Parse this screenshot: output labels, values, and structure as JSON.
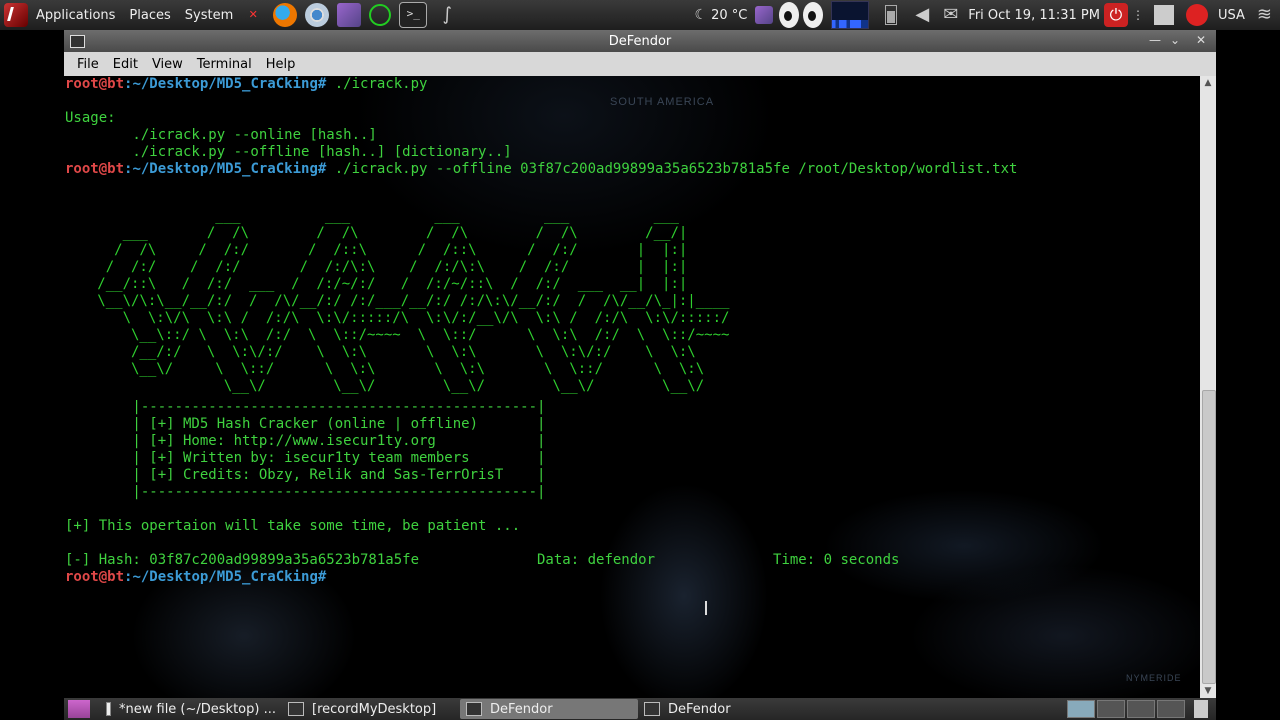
{
  "top_panel": {
    "menus": [
      "Applications",
      "Places",
      "System"
    ],
    "launchers": [
      {
        "icon": "chat-icon"
      },
      {
        "icon": "firefox-icon"
      },
      {
        "icon": "chrome-icon"
      },
      {
        "icon": "network-tool-icon"
      },
      {
        "icon": "wireless-icon"
      },
      {
        "icon": "terminal-icon"
      },
      {
        "icon": "wireshark-icon"
      }
    ],
    "chat_label": "chat",
    "weather": "20 °C",
    "clock": "Fri Oct 19, 11:31 PM",
    "keyboard_layout": "USA"
  },
  "window": {
    "title": "DeFendor",
    "menus": [
      {
        "label": "File"
      },
      {
        "label": "Edit"
      },
      {
        "label": "View"
      },
      {
        "label": "Terminal"
      },
      {
        "label": "Help"
      }
    ]
  },
  "terminal": {
    "prompt_user": "root@bt",
    "prompt_path": ":~/Desktop/MD5_CraCking#",
    "commands": [
      " ./icrack.py",
      " ./icrack.py --offline 03f87c200ad99899a35a6523b781a5fe /root/Desktop/wordlist.txt"
    ],
    "usage_title": "Usage:",
    "usage_lines": [
      "        ./icrack.py --online [hash..]",
      "        ./icrack.py --offline [hash..] [dictionary..]"
    ],
    "banner_ascii": "                 ___          ___          ___          ___          ___\n      ___       /  /\\        /  /\\        /  /\\        /  /\\        /__/|\n     /  /\\     /  /:/       /  /::\\      /  /::\\      /  /:/       |  |:|\n    /  /:/    /  /:/       /  /:/\\:\\    /  /:/\\:\\    /  /:/        |  |:|\n   /__/::\\   /  /:/  ___  /  /:/~/:/   /  /:/~/::\\  /  /:/  ___  __|  |:|\n   \\__\\/\\:\\__/__/:/  /  /\\/__/:/ /:/___/__/:/ /:/\\:\\/__/:/  /  /\\/__/\\_|:|____\n      \\  \\:\\/\\  \\:\\ /  /:/\\  \\:\\/:::::/\\  \\:\\/:/__\\/\\  \\:\\ /  /:/\\  \\:\\/:::::/\n       \\__\\::/ \\  \\:\\  /:/  \\  \\::/~~~~  \\  \\::/      \\  \\:\\  /:/  \\  \\::/~~~~\n       /__/:/   \\  \\:\\/:/    \\  \\:\\       \\  \\:\\       \\  \\:\\/:/    \\  \\:\\\n       \\__\\/     \\  \\::/      \\  \\:\\       \\  \\:\\       \\  \\::/      \\  \\:\\\n                  \\__\\/        \\__\\/        \\__\\/        \\__\\/        \\__\\/",
    "info_box": [
      "        |-----------------------------------------------|",
      "        | [+] MD5 Hash Cracker (online | offline)       |",
      "        | [+] Home: http://www.isecur1ty.org            |",
      "        | [+] Written by: isecur1ty team members        |",
      "        | [+] Credits: Obzy, Relik and Sas-TerrOrisT    |",
      "        |-----------------------------------------------|"
    ],
    "notice": "[+] This opertaion will take some time, be patient ...",
    "result": "[-] Hash: 03f87c200ad99899a35a6523b781a5fe              Data: defendor              Time: 0 seconds",
    "map_labels": [
      "SOUTH AMERICA",
      "NYMERIDE"
    ]
  },
  "taskbar": {
    "tasks": [
      {
        "label": "*new file (~/Desktop) ...",
        "icon": "text-editor-icon"
      },
      {
        "label": "[recordMyDesktop]",
        "icon": "window-icon"
      },
      {
        "label": "DeFendor",
        "icon": "terminal-icon",
        "active": true
      },
      {
        "label": "DeFendor",
        "icon": "terminal-icon",
        "active": false
      }
    ]
  }
}
